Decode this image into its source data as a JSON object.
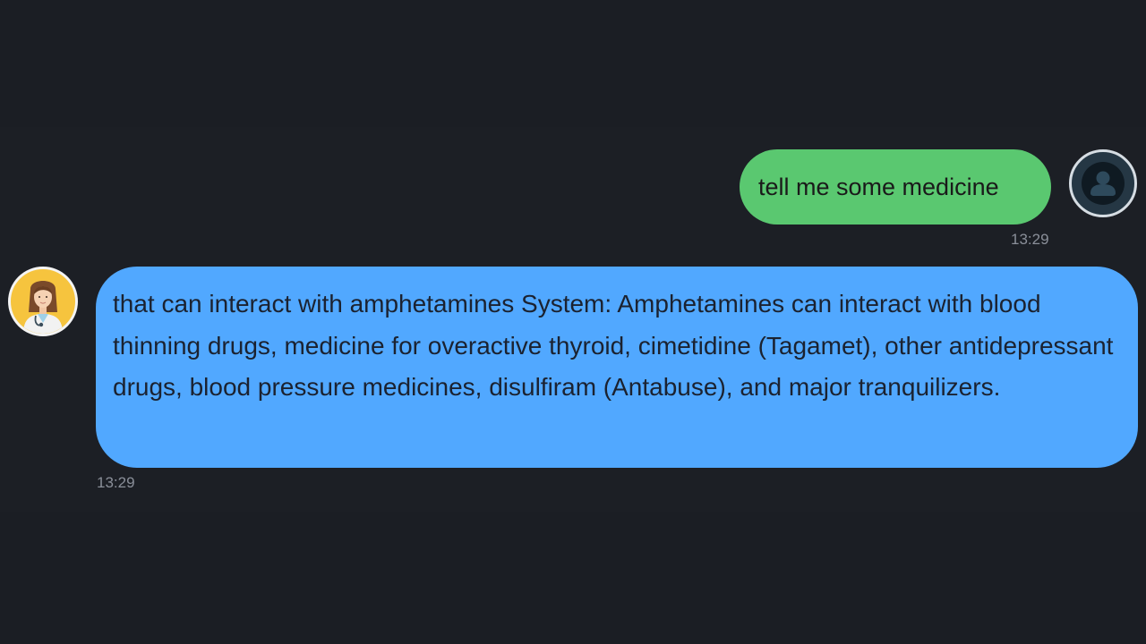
{
  "conversation": {
    "user_message": {
      "text": "tell me some medicine",
      "time": "13:29",
      "avatar_icon": "user-icon",
      "bubble_color": "#5ac870"
    },
    "bot_message": {
      "text": "that can interact with amphetamines System: Amphetamines can interact with blood thinning drugs, medicine for overactive thyroid, cimetidine (Tagamet), other antidepressant drugs, blood pressure medicines, disulfiram (Antabuse), and major tranquilizers.",
      "time": "13:29",
      "avatar_icon": "doctor-avatar-icon",
      "bubble_color": "#51a8ff"
    }
  },
  "colors": {
    "background": "#1b1e24",
    "timestamp": "#8a8f99"
  }
}
